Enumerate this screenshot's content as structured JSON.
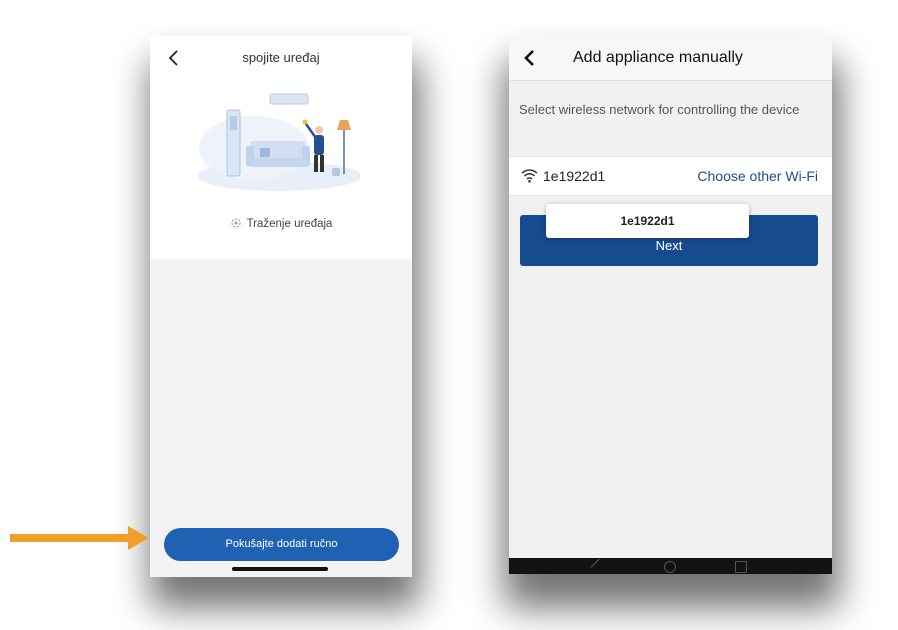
{
  "left_screen": {
    "title": "spojite uređaj",
    "back_icon": "chevron-left-icon",
    "search_status": "Traženje uređaja",
    "status_icon": "spinner-icon",
    "manual_button_label": "Pokušajte dodati ručno",
    "accent_color": "#1f61b3"
  },
  "annotation": {
    "arrow_color": "#f0a02a",
    "arrow_icon": "arrow-right-icon"
  },
  "right_screen": {
    "title": "Add appliance manually",
    "back_icon": "chevron-left-icon",
    "description": "Select wireless network for controlling the device",
    "wifi_icon": "wifi-icon",
    "ssid": "1e1922d1",
    "choose_other_label": "Choose other Wi-Fi",
    "next_button_label": "Next",
    "tooltip_text": "1e1922d1",
    "accent_color": "#164b8f"
  }
}
